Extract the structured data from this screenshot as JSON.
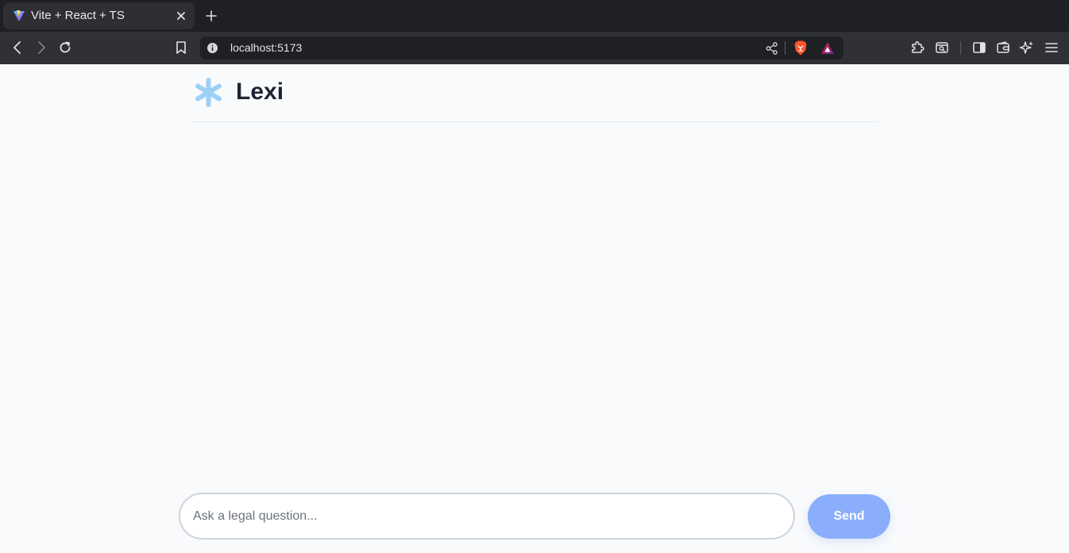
{
  "browser": {
    "tab": {
      "title": "Vite + React + TS",
      "favicon": "vite-logo-icon"
    },
    "url": "localhost:5173",
    "icons": {
      "back": "chevron-left-icon",
      "forward": "chevron-right-icon",
      "reload": "reload-icon",
      "bookmark": "bookmark-icon",
      "site_info": "info-icon",
      "share": "share-icon",
      "shields": "brave-lion-icon",
      "rewards": "rewards-triangle-icon",
      "extensions": "puzzle-icon",
      "tab_search": "tab-search-icon",
      "sidebar": "sidebar-icon",
      "wallet": "wallet-icon",
      "leo": "sparkle-icon",
      "menu": "hamburger-menu-icon"
    }
  },
  "app": {
    "title": "Lexi",
    "logo": "asterisk-icon",
    "composer": {
      "placeholder": "Ask a legal question...",
      "value": "",
      "send_label": "Send"
    }
  },
  "colors": {
    "accent": "#8aaefb",
    "logo": "#9dd0f5",
    "page_background": "#f8fafc",
    "title": "#1e2433"
  }
}
